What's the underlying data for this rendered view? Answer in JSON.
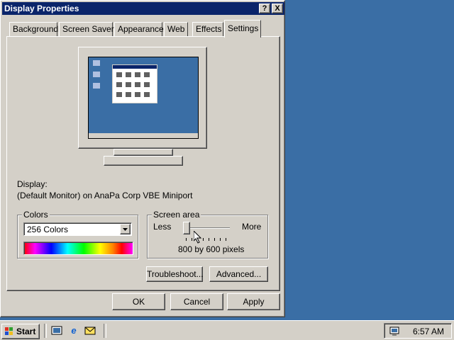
{
  "window": {
    "title": "Display Properties",
    "help_button": "?",
    "close_button": "X"
  },
  "tabs": [
    {
      "label": "Background"
    },
    {
      "label": "Screen Saver"
    },
    {
      "label": "Appearance"
    },
    {
      "label": "Web"
    },
    {
      "label": "Effects"
    },
    {
      "label": "Settings",
      "active": true
    }
  ],
  "settings": {
    "display_label": "Display:",
    "display_value": "(Default Monitor) on AnaPa Corp VBE Miniport",
    "colors": {
      "group_title": "Colors",
      "selected": "256 Colors"
    },
    "screen_area": {
      "group_title": "Screen area",
      "less_label": "Less",
      "more_label": "More",
      "resolution": "800 by 600 pixels",
      "slider_level": 0
    },
    "troubleshoot_button": "Troubleshoot...",
    "advanced_button": "Advanced..."
  },
  "dialog_buttons": {
    "ok": "OK",
    "cancel": "Cancel",
    "apply": "Apply"
  },
  "taskbar": {
    "start_label": "Start",
    "quick_launch": [
      "desktop-icon",
      "ie-icon",
      "outlook-icon"
    ],
    "clock": "6:57 AM"
  },
  "colors": {
    "desktop": "#3a6ea5",
    "titlebar": "#0a246a",
    "face": "#d4d0c8"
  }
}
